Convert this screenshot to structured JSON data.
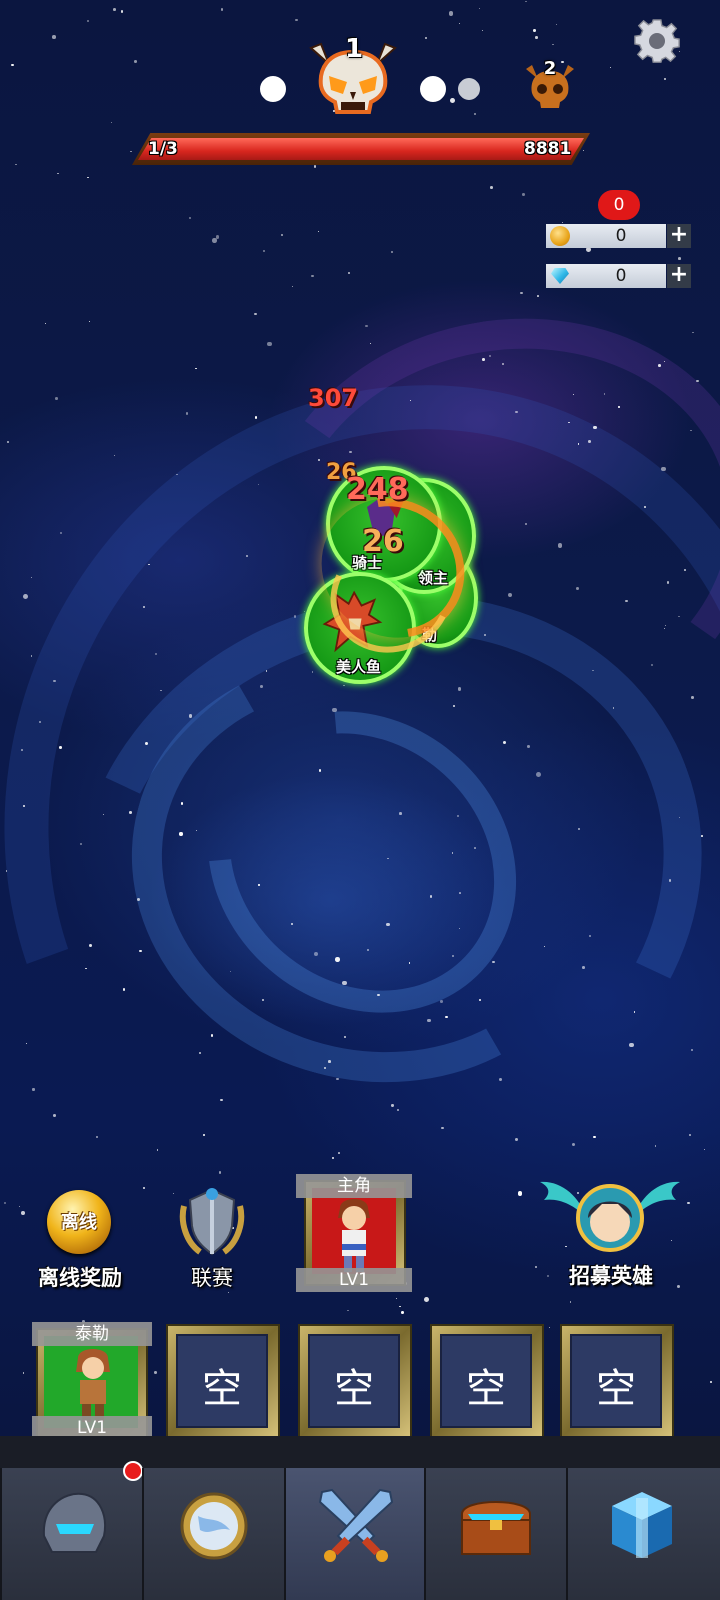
{
  "stage": {
    "current_boss_num": "1",
    "next_boss_num": "2",
    "hp_progress": "1/3",
    "hp_value": "8881"
  },
  "currency": {
    "badge": "0",
    "coins": "0",
    "gems": "0",
    "plus": "+"
  },
  "battle": {
    "damage_numbers": [
      "307",
      "248",
      "26",
      "26"
    ],
    "units": [
      "美人鱼",
      "领主",
      "勒",
      "骑士"
    ]
  },
  "actions": {
    "offline_orb": "离线",
    "offline_label": "离线奖励",
    "league_label": "联赛",
    "hero_title": "主角",
    "hero_level": "LV1",
    "recruit_label": "招募英雄"
  },
  "slots": [
    {
      "name": "泰勒",
      "level": "LV1"
    },
    {
      "text": "空"
    },
    {
      "text": "空"
    },
    {
      "text": "空"
    },
    {
      "text": "空"
    }
  ],
  "nav": {
    "tabs": [
      "helmet-icon",
      "shield-icon",
      "crossed-swords-icon",
      "treasure-chest-icon",
      "gift-box-icon"
    ],
    "active_index": 2
  },
  "colors": {
    "hp_fill": "#d8261e",
    "badge_red": "#e01818",
    "unit_green": "#169a16"
  }
}
